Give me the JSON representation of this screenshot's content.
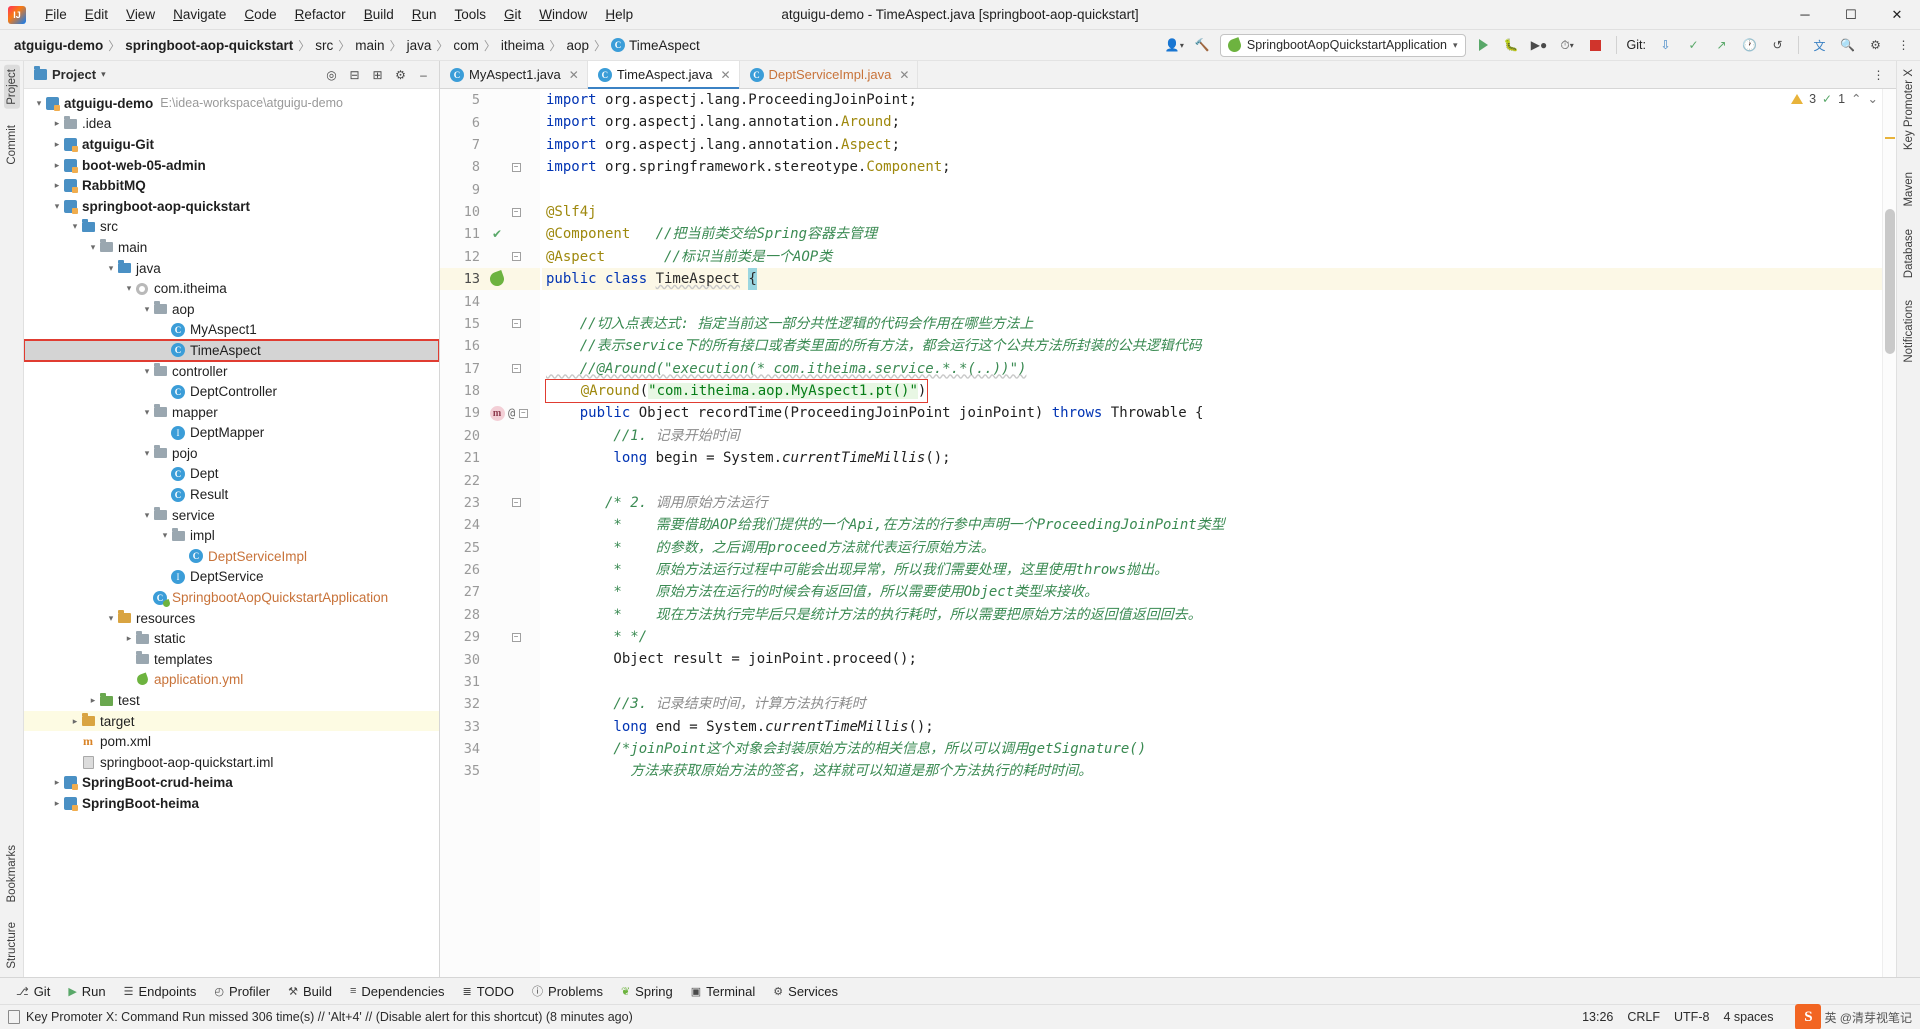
{
  "window": {
    "title": "atguigu-demo - TimeAspect.java [springboot-aop-quickstart]",
    "minimize": "─",
    "maximize": "☐",
    "close": "✕"
  },
  "menubar": {
    "items": [
      "File",
      "Edit",
      "View",
      "Navigate",
      "Code",
      "Refactor",
      "Build",
      "Run",
      "Tools",
      "Git",
      "Window",
      "Help"
    ]
  },
  "breadcrumb": {
    "items": [
      "atguigu-demo",
      "springboot-aop-quickstart",
      "src",
      "main",
      "java",
      "com",
      "itheima",
      "aop",
      "TimeAspect"
    ],
    "separator": "〉",
    "class_badge": "C"
  },
  "nav_right": {
    "run_config": "SpringbootAopQuickstartApplication",
    "run_config_chevron": "▾",
    "git_label": "Git:",
    "icons": [
      "user-avatar-icon",
      "hammer-icon",
      "run-icon",
      "debug-icon",
      "coverage-icon",
      "profile-icon",
      "stop-icon",
      "git-update-icon",
      "git-commit-icon",
      "git-push-icon",
      "history-icon",
      "rollback-icon",
      "translate-icon",
      "search-icon",
      "settings-icon",
      "more-icon"
    ]
  },
  "left_rail": {
    "top": [
      "Project"
    ],
    "bottom": [
      "Bookmarks",
      "Structure"
    ],
    "commit": "Commit"
  },
  "right_rail": {
    "items": [
      "Key Promoter X",
      "Maven",
      "Database",
      "Notifications"
    ]
  },
  "project_panel": {
    "title": "Project",
    "chevron": "▾",
    "toolbar_icons": [
      "locate-icon",
      "collapse-all-icon",
      "expand-icon",
      "settings-icon",
      "hide-icon"
    ],
    "tree": [
      {
        "depth": 0,
        "arrow": "▾",
        "icon": "module",
        "label": "atguigu-demo",
        "bold": true,
        "path": "E:\\idea-workspace\\atguigu-demo"
      },
      {
        "depth": 1,
        "arrow": "▸",
        "icon": "folder",
        "label": ".idea"
      },
      {
        "depth": 1,
        "arrow": "▸",
        "icon": "module",
        "label": "atguigu-Git",
        "bold": true
      },
      {
        "depth": 1,
        "arrow": "▸",
        "icon": "module",
        "label": "boot-web-05-admin",
        "bold": true
      },
      {
        "depth": 1,
        "arrow": "▸",
        "icon": "module",
        "label": "RabbitMQ",
        "bold": true
      },
      {
        "depth": 1,
        "arrow": "▾",
        "icon": "module",
        "label": "springboot-aop-quickstart",
        "bold": true
      },
      {
        "depth": 2,
        "arrow": "▾",
        "icon": "folder-src",
        "label": "src"
      },
      {
        "depth": 3,
        "arrow": "▾",
        "icon": "folder",
        "label": "main"
      },
      {
        "depth": 4,
        "arrow": "▾",
        "icon": "folder-src",
        "label": "java"
      },
      {
        "depth": 5,
        "arrow": "▾",
        "icon": "package",
        "label": "com.itheima"
      },
      {
        "depth": 6,
        "arrow": "▾",
        "icon": "folder",
        "label": "aop"
      },
      {
        "depth": 7,
        "arrow": "",
        "icon": "class",
        "label": "MyAspect1"
      },
      {
        "depth": 7,
        "arrow": "",
        "icon": "class",
        "label": "TimeAspect",
        "selected": true,
        "redbox": true
      },
      {
        "depth": 6,
        "arrow": "▾",
        "icon": "folder",
        "label": "controller"
      },
      {
        "depth": 7,
        "arrow": "",
        "icon": "class",
        "label": "DeptController"
      },
      {
        "depth": 6,
        "arrow": "▾",
        "icon": "folder",
        "label": "mapper"
      },
      {
        "depth": 7,
        "arrow": "",
        "icon": "interface",
        "label": "DeptMapper"
      },
      {
        "depth": 6,
        "arrow": "▾",
        "icon": "folder",
        "label": "pojo"
      },
      {
        "depth": 7,
        "arrow": "",
        "icon": "class",
        "label": "Dept"
      },
      {
        "depth": 7,
        "arrow": "",
        "icon": "class",
        "label": "Result"
      },
      {
        "depth": 6,
        "arrow": "▾",
        "icon": "folder",
        "label": "service"
      },
      {
        "depth": 7,
        "arrow": "▾",
        "icon": "folder",
        "label": "impl"
      },
      {
        "depth": 8,
        "arrow": "",
        "icon": "class",
        "label": "DeptServiceImpl",
        "orange": true
      },
      {
        "depth": 7,
        "arrow": "",
        "icon": "interface",
        "label": "DeptService"
      },
      {
        "depth": 6,
        "arrow": "",
        "icon": "spring-class",
        "label": "SpringbootAopQuickstartApplication",
        "orange": true
      },
      {
        "depth": 4,
        "arrow": "▾",
        "icon": "folder-res",
        "label": "resources"
      },
      {
        "depth": 5,
        "arrow": "▸",
        "icon": "folder",
        "label": "static"
      },
      {
        "depth": 5,
        "arrow": "",
        "icon": "folder",
        "label": "templates"
      },
      {
        "depth": 5,
        "arrow": "",
        "icon": "yml",
        "label": "application.yml",
        "orange": true
      },
      {
        "depth": 3,
        "arrow": "▸",
        "icon": "folder-test",
        "label": "test"
      },
      {
        "depth": 2,
        "arrow": "▸",
        "icon": "folder-target",
        "label": "target",
        "highlight": true
      },
      {
        "depth": 2,
        "arrow": "",
        "icon": "xml",
        "label": "pom.xml"
      },
      {
        "depth": 2,
        "arrow": "",
        "icon": "file",
        "label": "springboot-aop-quickstart.iml"
      },
      {
        "depth": 1,
        "arrow": "▸",
        "icon": "module",
        "label": "SpringBoot-crud-heima",
        "bold": true
      },
      {
        "depth": 1,
        "arrow": "▸",
        "icon": "module",
        "label": "SpringBoot-heima",
        "bold": true
      }
    ]
  },
  "editor": {
    "tabs": [
      {
        "label": "MyAspect1.java",
        "badge": "C",
        "active": false,
        "orange": false
      },
      {
        "label": "TimeAspect.java",
        "badge": "C",
        "active": true,
        "orange": false
      },
      {
        "label": "DeptServiceImpl.java",
        "badge": "C",
        "active": false,
        "orange": true
      }
    ],
    "tab_close": "✕",
    "inspection": {
      "warnings": "3",
      "checks": "1",
      "warn_icon": "warning-triangle-icon",
      "check_icon": "check-icon",
      "chevron_up": "⌃",
      "chevron_down": "⌄"
    },
    "first_line_number": 5,
    "current_line": 13,
    "lines": [
      {
        "n": 5,
        "marker": "",
        "fold": "",
        "tokens": [
          {
            "t": "import ",
            "c": "kw"
          },
          {
            "t": "org.aspectj.lang.ProceedingJoinPoint;",
            "c": "typ"
          }
        ]
      },
      {
        "n": 6,
        "marker": "",
        "fold": "",
        "tokens": [
          {
            "t": "import ",
            "c": "kw"
          },
          {
            "t": "org.aspectj.lang.annotation.",
            "c": "typ"
          },
          {
            "t": "Around",
            "c": "ann"
          },
          {
            "t": ";",
            "c": "typ"
          }
        ]
      },
      {
        "n": 7,
        "marker": "",
        "fold": "",
        "tokens": [
          {
            "t": "import ",
            "c": "kw"
          },
          {
            "t": "org.aspectj.lang.annotation.",
            "c": "typ"
          },
          {
            "t": "Aspect",
            "c": "ann"
          },
          {
            "t": ";",
            "c": "typ"
          }
        ]
      },
      {
        "n": 8,
        "marker": "",
        "fold": "minus",
        "tokens": [
          {
            "t": "import ",
            "c": "kw"
          },
          {
            "t": "org.springframework.stereotype.",
            "c": "typ"
          },
          {
            "t": "Component",
            "c": "ann"
          },
          {
            "t": ";",
            "c": "typ"
          }
        ]
      },
      {
        "n": 9,
        "marker": "",
        "fold": "",
        "tokens": []
      },
      {
        "n": 10,
        "marker": "",
        "fold": "tri",
        "tokens": [
          {
            "t": "@Slf4j",
            "c": "ann"
          }
        ]
      },
      {
        "n": 11,
        "marker": "check",
        "fold": "",
        "tokens": [
          {
            "t": "@Component",
            "c": "ann"
          },
          {
            "t": "   ",
            "c": "typ"
          },
          {
            "t": "//把当前类交给Spring容器去管理",
            "c": "cmt-g"
          }
        ]
      },
      {
        "n": 12,
        "marker": "",
        "fold": "minus",
        "tokens": [
          {
            "t": "@Aspect",
            "c": "ann"
          },
          {
            "t": "       ",
            "c": "typ"
          },
          {
            "t": "//标识当前类是一个AOP类",
            "c": "cmt-g"
          }
        ]
      },
      {
        "n": 13,
        "marker": "bean",
        "fold": "",
        "current": true,
        "tokens": [
          {
            "t": "public class ",
            "c": "kw"
          },
          {
            "t": "TimeAspect",
            "c": "squiggle"
          },
          {
            "t": " ",
            "c": "typ"
          },
          {
            "t": "{",
            "c": "caret"
          }
        ]
      },
      {
        "n": 14,
        "marker": "",
        "fold": "",
        "tokens": []
      },
      {
        "n": 15,
        "marker": "",
        "fold": "tri",
        "tokens": [
          {
            "t": "    //切入点表达式: 指定当前这一部分共性逻辑的代码会作用在哪些方法上",
            "c": "cmt-g"
          }
        ]
      },
      {
        "n": 16,
        "marker": "",
        "fold": "",
        "tokens": [
          {
            "t": "    //表示service下的所有接口或者类里面的所有方法，都会运行这个公共方法所封装的公共逻辑代码",
            "c": "cmt-g"
          }
        ]
      },
      {
        "n": 17,
        "marker": "",
        "fold": "minus",
        "tokens": [
          {
            "t": "    //@Around(\"execution(* com.itheima.service.*.*(..))\")",
            "c": "cmt-g squiggle"
          }
        ]
      },
      {
        "n": 18,
        "marker": "",
        "fold": "",
        "redbox": true,
        "tokens": [
          {
            "t": "    @Around",
            "c": "ann"
          },
          {
            "t": "(",
            "c": "typ"
          },
          {
            "t": "\"com.itheima.aop.MyAspect1.pt()\"",
            "c": "str hl-green"
          },
          {
            "t": ")",
            "c": "typ"
          }
        ]
      },
      {
        "n": 19,
        "marker": "m",
        "gutter_at": "@",
        "fold": "tri",
        "tokens": [
          {
            "t": "    public ",
            "c": "kw"
          },
          {
            "t": "Object ",
            "c": "typ"
          },
          {
            "t": "recordTime",
            "c": "fn"
          },
          {
            "t": "(ProceedingJoinPoint joinPoint) ",
            "c": "typ"
          },
          {
            "t": "throws ",
            "c": "kw"
          },
          {
            "t": "Throwable {",
            "c": "typ"
          }
        ]
      },
      {
        "n": 20,
        "marker": "",
        "fold": "",
        "tokens": [
          {
            "t": "        //1. ",
            "c": "cmt-g"
          },
          {
            "t": "记录开始时间",
            "c": "cmt"
          }
        ]
      },
      {
        "n": 21,
        "marker": "",
        "fold": "",
        "tokens": [
          {
            "t": "        long ",
            "c": "kw"
          },
          {
            "t": "begin = System.",
            "c": "typ"
          },
          {
            "t": "currentTimeMillis",
            "c": "typ ital"
          },
          {
            "t": "();",
            "c": "typ"
          }
        ]
      },
      {
        "n": 22,
        "marker": "",
        "fold": "",
        "tokens": []
      },
      {
        "n": 23,
        "marker": "",
        "fold": "tri",
        "tokens": [
          {
            "t": "       /* 2. ",
            "c": "cmt-g"
          },
          {
            "t": "调用原始方法运行",
            "c": "cmt"
          }
        ]
      },
      {
        "n": 24,
        "marker": "",
        "fold": "",
        "tokens": [
          {
            "t": "        *    需要借助AOP给我们提供的一个Api,在方法的行参中声明一个ProceedingJoinPoint类型",
            "c": "cmt-g"
          }
        ]
      },
      {
        "n": 25,
        "marker": "",
        "fold": "",
        "tokens": [
          {
            "t": "        *    的参数，之后调用proceed方法就代表运行原始方法。",
            "c": "cmt-g"
          }
        ]
      },
      {
        "n": 26,
        "marker": "",
        "fold": "",
        "tokens": [
          {
            "t": "        *    原始方法运行过程中可能会出现异常，所以我们需要处理，这里使用throws抛出。",
            "c": "cmt-g"
          }
        ]
      },
      {
        "n": 27,
        "marker": "",
        "fold": "",
        "tokens": [
          {
            "t": "        *    原始方法在运行的时候会有返回值，所以需要使用Object类型来接收。",
            "c": "cmt-g"
          }
        ]
      },
      {
        "n": 28,
        "marker": "",
        "fold": "",
        "tokens": [
          {
            "t": "        *    现在方法执行完毕后只是统计方法的执行耗时，所以需要把原始方法的返回值返回回去。",
            "c": "cmt-g"
          }
        ]
      },
      {
        "n": 29,
        "marker": "",
        "fold": "minus",
        "tokens": [
          {
            "t": "        * */",
            "c": "cmt-g"
          }
        ]
      },
      {
        "n": 30,
        "marker": "",
        "fold": "",
        "tokens": [
          {
            "t": "        Object result = joinPoint.",
            "c": "typ"
          },
          {
            "t": "proceed",
            "c": "typ"
          },
          {
            "t": "();",
            "c": "typ"
          }
        ]
      },
      {
        "n": 31,
        "marker": "",
        "fold": "",
        "tokens": []
      },
      {
        "n": 32,
        "marker": "",
        "fold": "",
        "tokens": [
          {
            "t": "        //3. ",
            "c": "cmt-g"
          },
          {
            "t": "记录结束时间，计算方法执行耗时",
            "c": "cmt"
          }
        ]
      },
      {
        "n": 33,
        "marker": "",
        "fold": "",
        "tokens": [
          {
            "t": "        long ",
            "c": "kw"
          },
          {
            "t": "end = System.",
            "c": "typ"
          },
          {
            "t": "currentTimeMillis",
            "c": "typ ital"
          },
          {
            "t": "();",
            "c": "typ"
          }
        ]
      },
      {
        "n": 34,
        "marker": "",
        "fold": "",
        "tokens": [
          {
            "t": "        /*joinPoint",
            "c": "cmt-g"
          },
          {
            "t": "这个对象会封装原始方法的相关信息，所以可以调用",
            "c": "cmt-g"
          },
          {
            "t": "getSignature()",
            "c": "cmt-g"
          }
        ]
      },
      {
        "n": 35,
        "marker": "",
        "fold": "",
        "tokens": [
          {
            "t": "          方法来获取原始方法的签名，这样就可以知道是那个方法执行的耗时时间。",
            "c": "cmt-g"
          }
        ]
      }
    ]
  },
  "bottom_toolwindows": [
    {
      "label": "Git",
      "icon": "git-branch-icon"
    },
    {
      "label": "Run",
      "icon": "run-play-icon"
    },
    {
      "label": "Endpoints",
      "icon": "endpoints-icon"
    },
    {
      "label": "Profiler",
      "icon": "profiler-icon"
    },
    {
      "label": "Build",
      "icon": "build-hammer-icon"
    },
    {
      "label": "Dependencies",
      "icon": "dependencies-icon"
    },
    {
      "label": "TODO",
      "icon": "todo-list-icon"
    },
    {
      "label": "Problems",
      "icon": "problems-icon"
    },
    {
      "label": "Spring",
      "icon": "spring-leaf-icon"
    },
    {
      "label": "Terminal",
      "icon": "terminal-icon"
    },
    {
      "label": "Services",
      "icon": "services-icon"
    }
  ],
  "statusbar": {
    "message": "Key Promoter X: Command Run missed 306 time(s) // 'Alt+4' // (Disable alert for this shortcut) (8 minutes ago)",
    "time": "13:26",
    "line_sep": "CRLF",
    "encoding": "UTF-8",
    "indent": "4 spaces",
    "watermark_badge": "S",
    "watermark_text": "英 @清芽视笔记"
  },
  "colors": {
    "accent_blue": "#3b82c4",
    "red_highlight": "#e03c31",
    "green_string": "#067d17",
    "annotation_gold": "#9e880d",
    "keyword_blue": "#0033b3",
    "comment_green": "#3a8a52"
  }
}
